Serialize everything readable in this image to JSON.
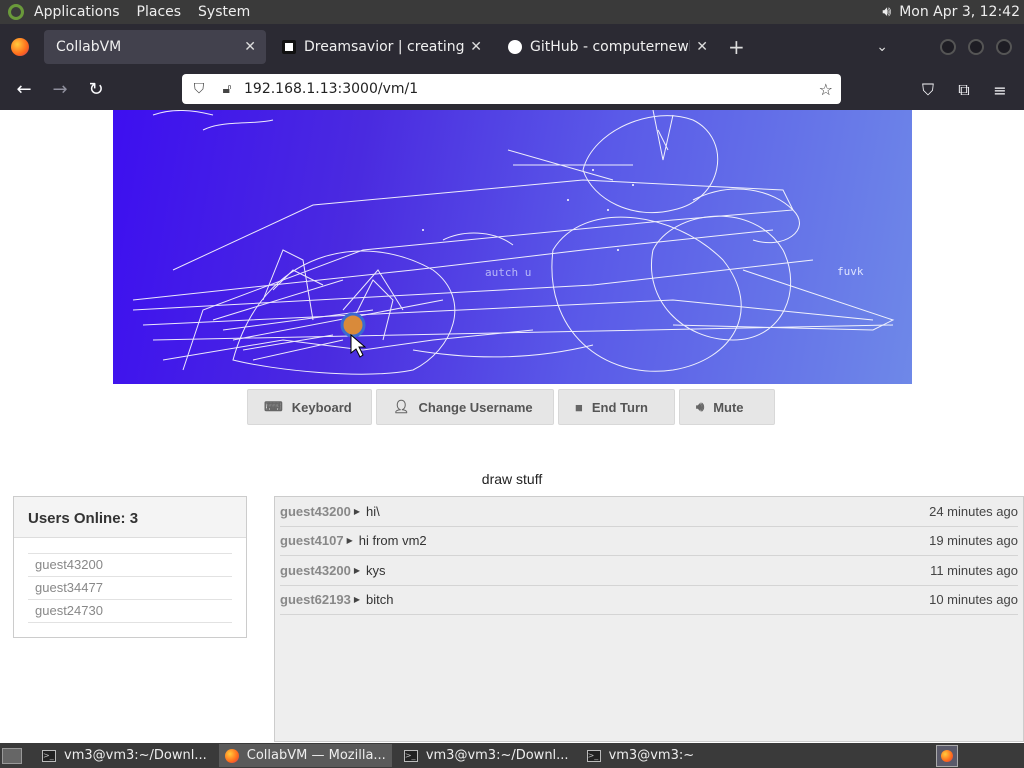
{
  "top_panel": {
    "menus": [
      "Applications",
      "Places",
      "System"
    ],
    "clock": "Mon Apr  3, 12:42"
  },
  "tabs": [
    {
      "title": "CollabVM",
      "active": true
    },
    {
      "title": "Dreamsavior | creating Gam",
      "active": false
    },
    {
      "title": "GitHub - computernewb/coll",
      "active": false
    }
  ],
  "urlbar": {
    "url": "192.168.1.13:3000/vm/1"
  },
  "vm_screen": {
    "texts": [
      "fuvk",
      "autch u"
    ]
  },
  "controls": {
    "keyboard": "Keyboard",
    "change_username": "Change Username",
    "end_turn": "End Turn",
    "mute": "Mute"
  },
  "motd": "draw stuff",
  "users": {
    "heading": "Users Online: 3",
    "list": [
      "guest43200",
      "guest34477",
      "guest24730"
    ]
  },
  "chat": [
    {
      "user": "guest43200",
      "message": "hi\\",
      "time": "24 minutes ago"
    },
    {
      "user": "guest4107",
      "message": "hi from vm2",
      "time": "19 minutes ago"
    },
    {
      "user": "guest43200",
      "message": "kys",
      "time": "11 minutes ago"
    },
    {
      "user": "guest62193",
      "message": "bitch",
      "time": "10 minutes ago"
    }
  ],
  "taskbar": {
    "tasks": [
      {
        "label": "vm3@vm3:~/Downl...",
        "active": false
      },
      {
        "label": "CollabVM — Mozilla...",
        "active": true
      },
      {
        "label": "vm3@vm3:~/Downl...",
        "active": false
      },
      {
        "label": "vm3@vm3:~",
        "active": false
      }
    ]
  },
  "colors": {
    "chrome_dark": "#2b2a33",
    "panel_gray": "#3a3a3a",
    "vm_blue": "#3d0ff0"
  }
}
